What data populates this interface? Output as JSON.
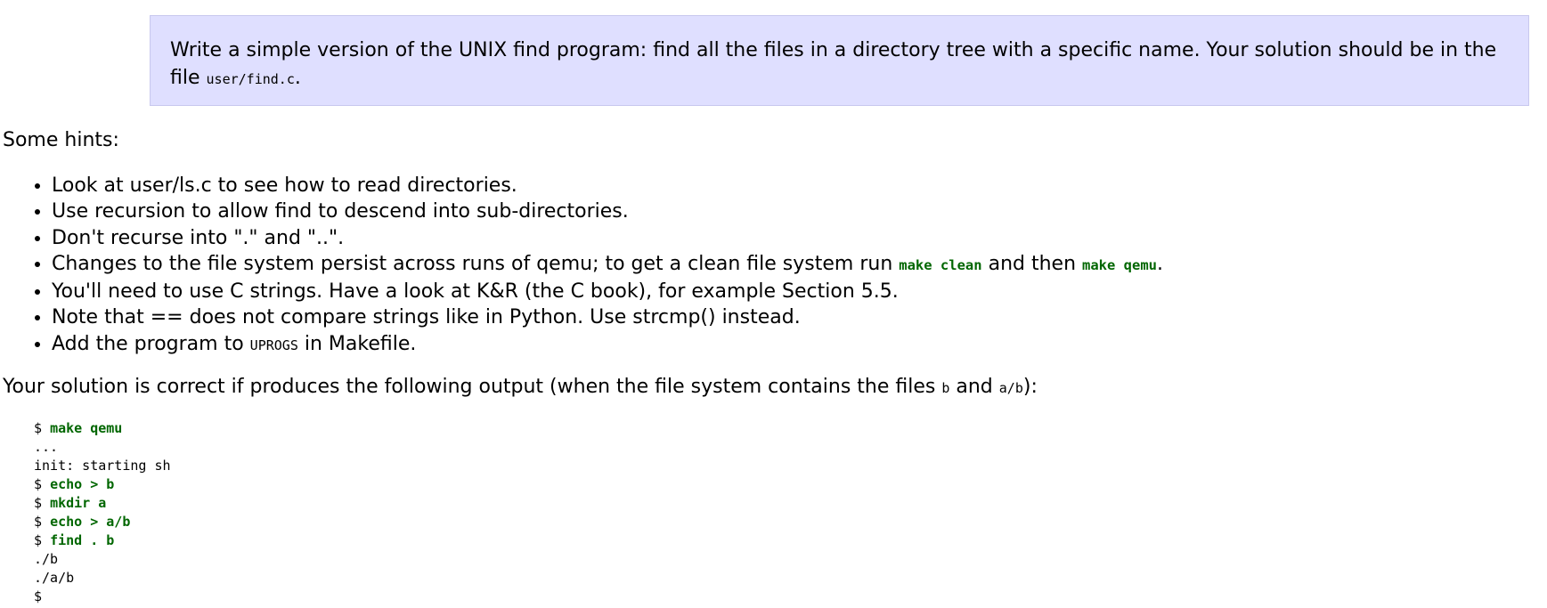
{
  "assignment": {
    "text": "Write a simple version of the UNIX find program: find all the files in a directory tree with a specific name. Your solution should be in the file",
    "file": "user/find.c",
    "trail": "."
  },
  "hints": {
    "heading": "Some hints:",
    "items": [
      {
        "text": "Look at user/ls.c to see how to read directories."
      },
      {
        "text": "Use recursion to allow find to descend into sub-directories."
      },
      {
        "text": "Don't recurse into \".\" and \"..\"."
      },
      {
        "pre": "Changes to the file system persist across runs of qemu; to get a clean file system run ",
        "code1": "make clean",
        "mid": " and then ",
        "code2": "make qemu",
        "post": "."
      },
      {
        "text": "You'll need to use C strings. Have a look at K&R (the C book), for example Section 5.5."
      },
      {
        "text": "Note that == does not compare strings like in Python. Use strcmp() instead."
      },
      {
        "pre": "Add the program to ",
        "code1": "UPROGS",
        "post": " in Makefile."
      }
    ]
  },
  "result": {
    "pre": "Your solution is correct if produces the following output (when the file system contains the files ",
    "code1": "b",
    "mid": " and ",
    "code2": "a/b",
    "post": "):"
  },
  "terminal": {
    "lines": [
      {
        "prompt": "$ ",
        "cmd": "make qemu"
      },
      {
        "text": "..."
      },
      {
        "text": "init: starting sh"
      },
      {
        "prompt": "$ ",
        "cmd": "echo > b"
      },
      {
        "prompt": "$ ",
        "cmd": "mkdir a"
      },
      {
        "prompt": "$ ",
        "cmd": "echo > a/b"
      },
      {
        "prompt": "$ ",
        "cmd": "find . b"
      },
      {
        "text": "./b"
      },
      {
        "text": "./a/b"
      },
      {
        "prompt": "$",
        "cmd": ""
      }
    ]
  }
}
